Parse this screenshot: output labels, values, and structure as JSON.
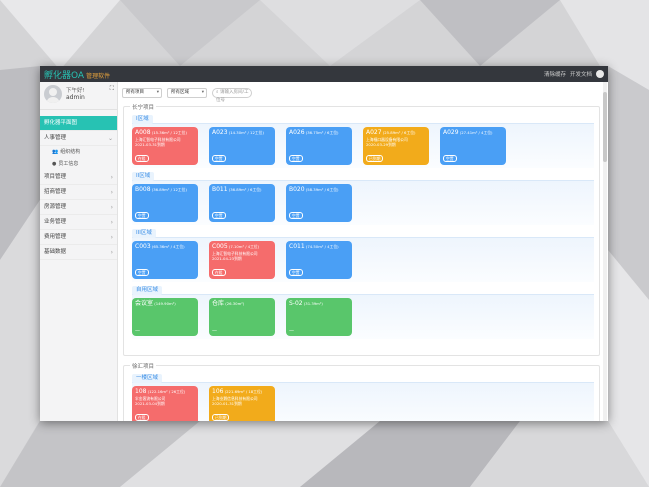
{
  "app": {
    "title": "孵化器OA",
    "subtitle": "管理软件"
  },
  "topbar": {
    "clear_cache": "清除缓存",
    "dev_docs": "开发文档"
  },
  "user": {
    "greeting": "下午好!",
    "name": "admin"
  },
  "sidebar": {
    "active": "孵化器平面图",
    "personnel": "人事管理",
    "sub": [
      "组织结构",
      "员工信息"
    ],
    "items": [
      "项目管理",
      "招商管理",
      "房源管理",
      "业务管理",
      "费用管理",
      "基础数据"
    ]
  },
  "filters": {
    "project": "所有项目",
    "region": "所有区域",
    "search_placeholder": "请输入房间/工位号"
  },
  "projects": [
    {
      "name": "长宁项目",
      "areas": [
        {
          "name": "I区域",
          "cards": [
            {
              "room": "A008",
              "detail": "(15.36m² / 12工位)",
              "company": "上海汇智电子科技有限公司",
              "date": "2021-03-31到期",
              "status": "在租",
              "color": "red"
            },
            {
              "room": "A023",
              "detail": "(14.30m² / 12工位)",
              "status": "空置",
              "color": "blue"
            },
            {
              "room": "A026",
              "detail": "(36.75m² / 6工位)",
              "status": "空置",
              "color": "blue"
            },
            {
              "room": "A027",
              "detail": "(25.89m² / 6工位)",
              "company": "上海福口器设备有限公司",
              "date": "2020-03-29到期",
              "status": "已到期",
              "color": "yellow"
            },
            {
              "room": "A029",
              "detail": "(27.41m² / 4工位)",
              "status": "空置",
              "color": "blue"
            }
          ]
        },
        {
          "name": "II区域",
          "cards": [
            {
              "room": "B008",
              "detail": "(36.89m² / 12工位)",
              "status": "空置",
              "color": "blue"
            },
            {
              "room": "B011",
              "detail": "(36.89m² / 6工位)",
              "status": "空置",
              "color": "blue"
            },
            {
              "room": "B020",
              "detail": "(58.39m² / 6工位)",
              "status": "空置",
              "color": "blue"
            }
          ]
        },
        {
          "name": "III区域",
          "cards": [
            {
              "room": "C003",
              "detail": "(65.36m² / 4工位)",
              "status": "空置",
              "color": "blue"
            },
            {
              "room": "C005",
              "detail": "(7.10m² / 4工位)",
              "company": "上海汇智电子科技有限公司",
              "date": "2021-04-23到期",
              "status": "在租",
              "color": "red"
            },
            {
              "room": "C011",
              "detail": "(74.50m² / 4工位)",
              "status": "空置",
              "color": "blue"
            }
          ]
        },
        {
          "name": "自用区域",
          "cards": [
            {
              "room": "会议室",
              "detail": "(149.90m²)",
              "status": "—",
              "color": "green"
            },
            {
              "room": "仓库",
              "detail": "(26.30m²)",
              "status": "—",
              "color": "green"
            },
            {
              "room": "S-02",
              "detail": "(31.39m²)",
              "status": "—",
              "color": "green"
            }
          ]
        }
      ]
    },
    {
      "name": "徐汇项目",
      "areas": [
        {
          "name": "一楼区域",
          "cards": [
            {
              "room": "108",
              "detail": "(122.16m² / 26工位)",
              "company": "伞金客流有限公司",
              "date": "2021-03-04到期",
              "status": "在租",
              "color": "red"
            },
            {
              "room": "106",
              "detail": "(221.69m² / 18工位)",
              "company": "上海业鹅信息科技有限公司",
              "date": "2020-01-31到期",
              "status": "已到期",
              "color": "yellow"
            }
          ]
        }
      ]
    }
  ]
}
